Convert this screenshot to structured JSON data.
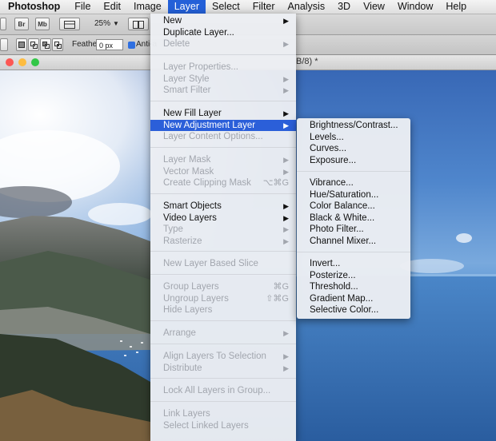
{
  "menubar": {
    "app": "Photoshop",
    "items": [
      "File",
      "Edit",
      "Image",
      "Layer",
      "Select",
      "Filter",
      "Analysis",
      "3D",
      "View",
      "Window",
      "Help"
    ]
  },
  "options": {
    "br": "Br",
    "mb": "Mb",
    "zoom": "25%",
    "feather_label": "Feather:",
    "feather_value": "0 px",
    "antialias_label": "Anti-a"
  },
  "document": {
    "title": "B/8) *"
  },
  "layer_menu": {
    "items": [
      {
        "label": "New",
        "arrow": "▶"
      },
      {
        "label": "Duplicate Layer..."
      },
      {
        "label": "Delete",
        "arrow": "▶"
      },
      {
        "label": "Layer Properties..."
      },
      {
        "label": "Layer Style",
        "arrow": "▶"
      },
      {
        "label": "Smart Filter",
        "arrow": "▶"
      },
      {
        "label": "New Fill Layer",
        "arrow": "▶"
      },
      {
        "label": "New Adjustment Layer",
        "arrow": "▶"
      },
      {
        "label": "Layer Content Options..."
      },
      {
        "label": "Layer Mask",
        "arrow": "▶"
      },
      {
        "label": "Vector Mask",
        "arrow": "▶"
      },
      {
        "label": "Create Clipping Mask",
        "shortcut": "⌥⌘G"
      },
      {
        "label": "Smart Objects",
        "arrow": "▶"
      },
      {
        "label": "Video Layers",
        "arrow": "▶"
      },
      {
        "label": "Type",
        "arrow": "▶"
      },
      {
        "label": "Rasterize",
        "arrow": "▶"
      },
      {
        "label": "New Layer Based Slice"
      },
      {
        "label": "Group Layers",
        "shortcut": "⌘G"
      },
      {
        "label": "Ungroup Layers",
        "shortcut": "⇧⌘G"
      },
      {
        "label": "Hide Layers"
      },
      {
        "label": "Arrange",
        "arrow": "▶"
      },
      {
        "label": "Align Layers To Selection",
        "arrow": "▶"
      },
      {
        "label": "Distribute",
        "arrow": "▶"
      },
      {
        "label": "Lock All Layers in Group..."
      },
      {
        "label": "Link Layers"
      },
      {
        "label": "Select Linked Layers"
      }
    ]
  },
  "adjustment_submenu": {
    "items": [
      {
        "label": "Brightness/Contrast..."
      },
      {
        "label": "Levels..."
      },
      {
        "label": "Curves..."
      },
      {
        "label": "Exposure..."
      },
      {
        "label": "Vibrance..."
      },
      {
        "label": "Hue/Saturation..."
      },
      {
        "label": "Color Balance..."
      },
      {
        "label": "Black & White..."
      },
      {
        "label": "Photo Filter..."
      },
      {
        "label": "Channel Mixer..."
      },
      {
        "label": "Invert..."
      },
      {
        "label": "Posterize..."
      },
      {
        "label": "Threshold..."
      },
      {
        "label": "Gradient Map..."
      },
      {
        "label": "Selective Color..."
      }
    ]
  },
  "colors": {
    "highlight": "#2b5fd9",
    "disabled_text": "#a2a6ae",
    "traffic_close": "#fc5753",
    "traffic_min": "#fdbc40",
    "traffic_max": "#33c748"
  }
}
